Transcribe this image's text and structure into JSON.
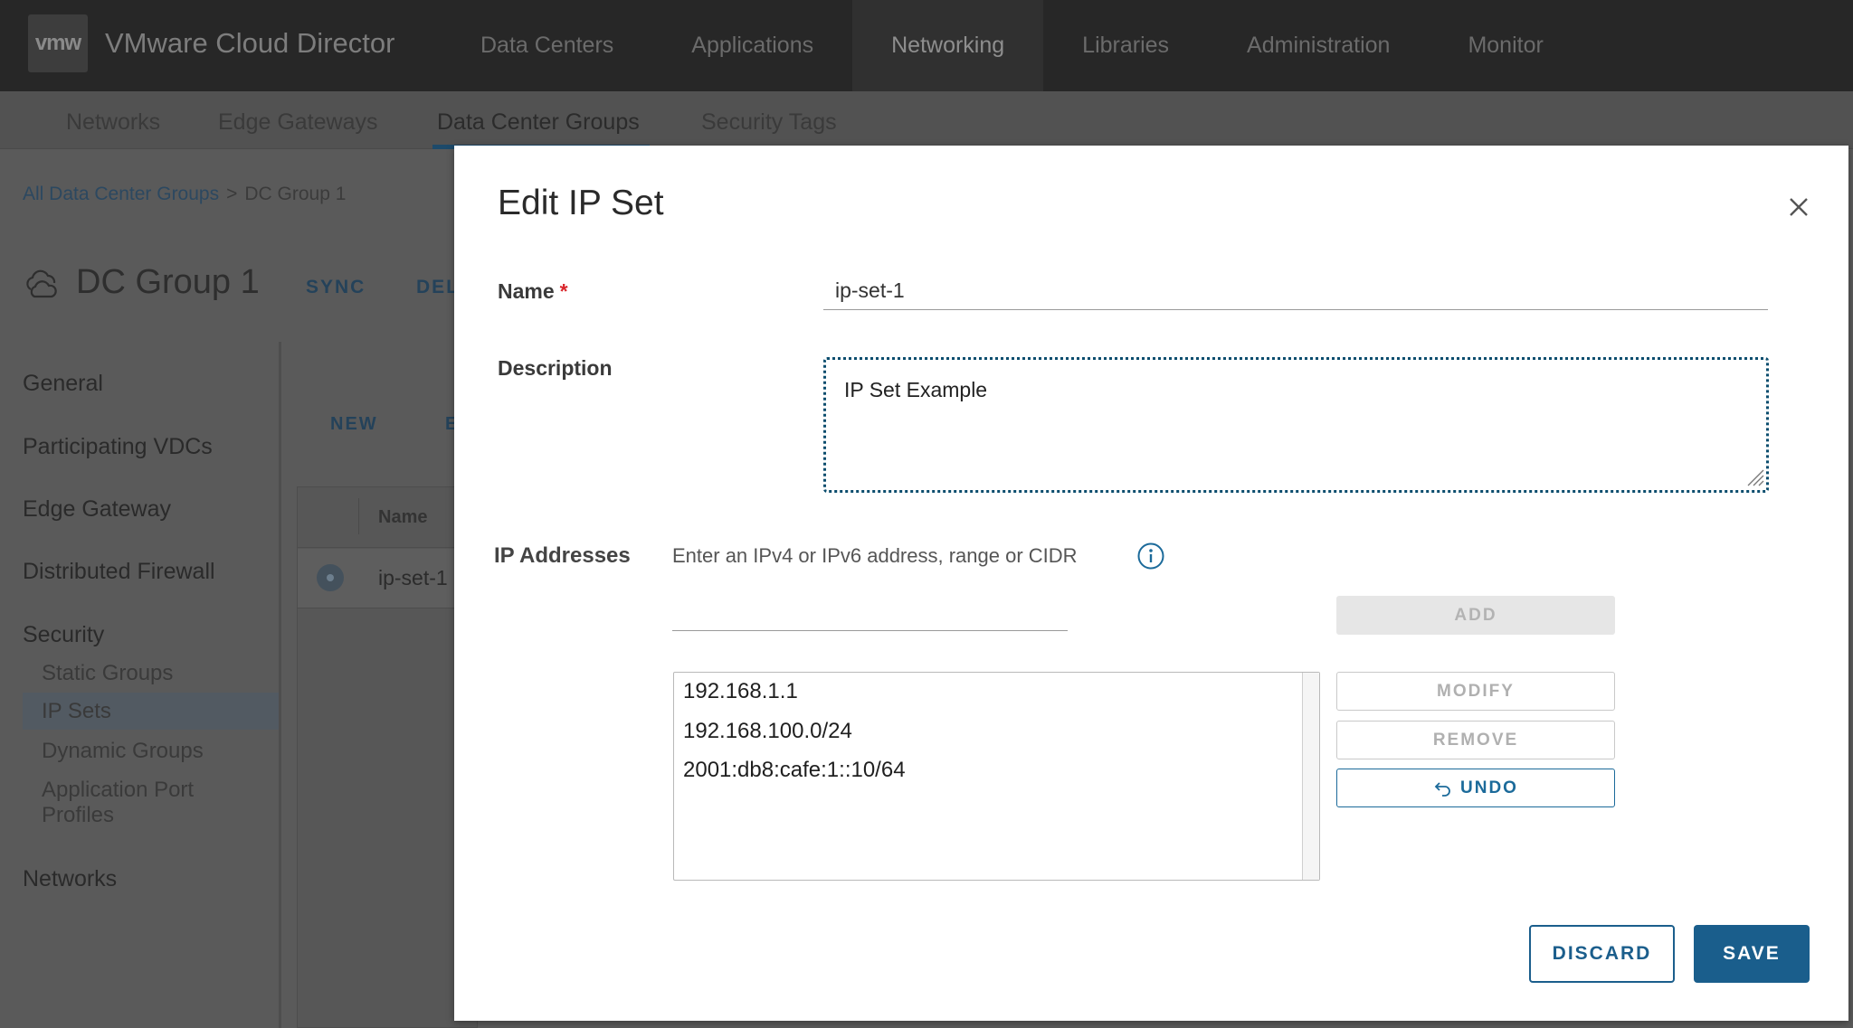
{
  "app": {
    "logo_text": "vmw",
    "title": "VMware Cloud Director"
  },
  "top_nav": [
    "Data Centers",
    "Applications",
    "Networking",
    "Libraries",
    "Administration",
    "Monitor"
  ],
  "top_nav_active": "Networking",
  "sub_nav": [
    "Networks",
    "Edge Gateways",
    "Data Center Groups",
    "Security Tags"
  ],
  "sub_nav_active": "Data Center Groups",
  "breadcrumb": {
    "root": "All Data Center Groups",
    "separator": ">",
    "current": "DC Group 1"
  },
  "page": {
    "title": "DC Group 1",
    "actions": [
      "SYNC",
      "DEL"
    ]
  },
  "sidebar": {
    "items": [
      "General",
      "Participating VDCs",
      "Edge Gateway",
      "Distributed Firewall",
      "Security"
    ],
    "security_sub": [
      "Static Groups",
      "IP Sets",
      "Dynamic Groups",
      "Application Port",
      "Profiles"
    ],
    "networks": "Networks",
    "active": "IP Sets"
  },
  "table": {
    "new_label": "NEW",
    "partial_action": "E",
    "col_name": "Name",
    "rows": [
      "ip-set-1"
    ]
  },
  "modal": {
    "title": "Edit IP Set",
    "name_label": "Name",
    "required_mark": "*",
    "name_value": "ip-set-1",
    "description_label": "Description",
    "description_value": "IP Set Example",
    "ip_label": "IP Addresses",
    "ip_hint": "Enter an IPv4 or IPv6 address, range or CIDR",
    "ip_input_value": "",
    "add_label": "ADD",
    "modify_label": "MODIFY",
    "remove_label": "REMOVE",
    "undo_label": "UNDO",
    "ip_list": [
      "192.168.1.1",
      "192.168.100.0/24",
      "2001:db8:cafe:1::10/64"
    ],
    "discard_label": "DISCARD",
    "save_label": "SAVE"
  },
  "colors": {
    "primary": "#1a5e8c",
    "required": "#d9262c",
    "topbar": "#272727"
  }
}
